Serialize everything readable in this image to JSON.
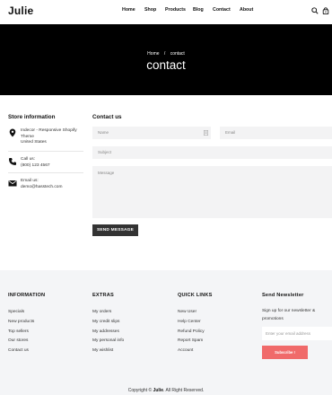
{
  "header": {
    "logo": "Julie",
    "nav": [
      "Home",
      "Shop",
      "Products",
      "Blog",
      "Contact",
      "About"
    ],
    "icons": [
      "search-icon",
      "bag-icon"
    ]
  },
  "banner": {
    "breadcrumb_home": "Home",
    "breadcrumb_sep": "/",
    "breadcrumb_current": "contact",
    "title": "contact"
  },
  "store": {
    "title": "Store information",
    "address": [
      "Indecor - Responsive Shopify",
      "Theme",
      "United States"
    ],
    "call_label": "Call us:",
    "phone": "(800) 123 4567",
    "email_label": "Email us:",
    "email": "demo@hasstech.com"
  },
  "contact": {
    "title": "Contact us",
    "name_placeholder": "Name",
    "email_placeholder": "Email",
    "subject_placeholder": "Subject",
    "message_placeholder": "Message",
    "send_label": "SEND MESSAGE"
  },
  "footer": {
    "information": {
      "title": "INFORMATION",
      "items": [
        "Specials",
        "New products",
        "Top sellers",
        "Our stores",
        "Contact us"
      ]
    },
    "extras": {
      "title": "EXTRAS",
      "items": [
        "My orders",
        "My credit slips",
        "My addresses",
        "My personal info",
        "My wishlist"
      ]
    },
    "quick_links": {
      "title": "QUICK LINKS",
      "items": [
        "New User",
        "Help Center",
        "Refund Policy",
        "Report Spam",
        "Account"
      ]
    },
    "newsletter": {
      "title": "Send Newsletter",
      "text": "Sign up for our newsletter & promotions",
      "placeholder": "Enter your email address",
      "button": "Subscribe !"
    },
    "copyright_prefix": "Copyright ©",
    "copyright_brand": "Julie",
    "copyright_suffix": ". All Right Reserved."
  },
  "colors": {
    "banner": "#000000",
    "button": "#333333",
    "subscribe": "#f06a6a",
    "footer_bg": "#f4f5f7"
  }
}
